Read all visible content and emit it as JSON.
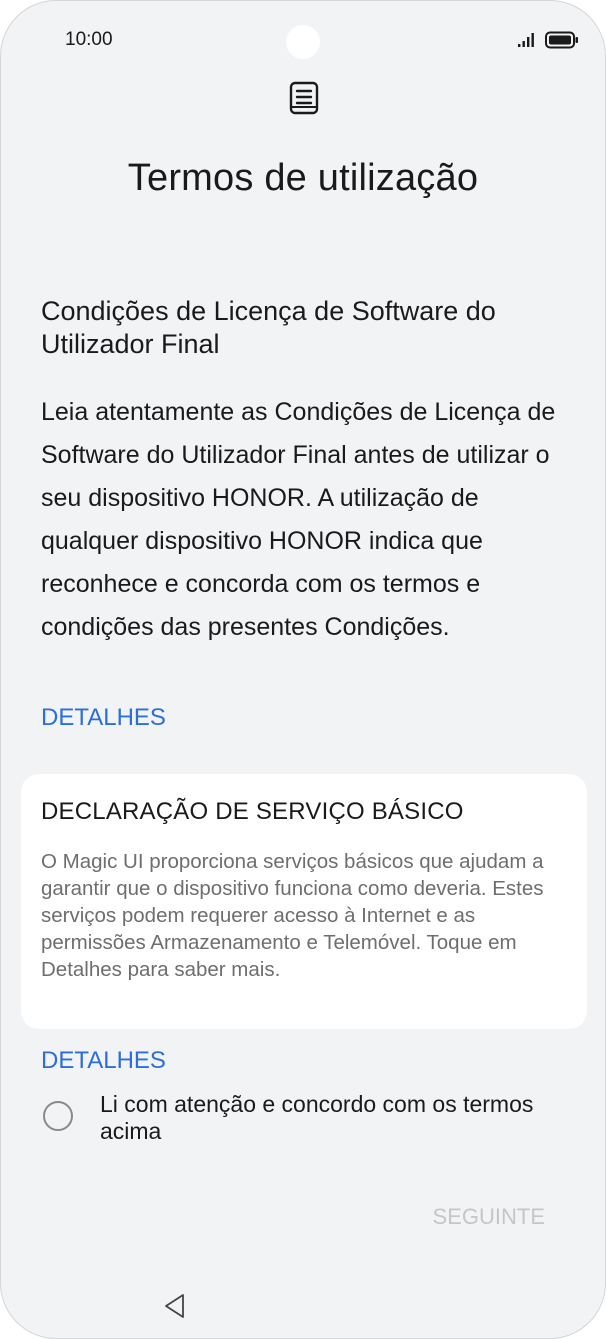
{
  "status_bar": {
    "time": "10:00",
    "icons": [
      "signal-icon",
      "battery-icon"
    ]
  },
  "header": {
    "icon": "document-icon",
    "title": "Termos de utilização"
  },
  "eula": {
    "title": "Condições de Licença de Software do Utilizador Final",
    "body": "Leia atentamente as Condições de Licença de Software do Utilizador Final antes de utilizar o seu dispositivo HONOR. A utilização de qualquer dispositivo HONOR indica que reconhece e concorda com os termos e condições das presentes Condições.",
    "details_label": "DETALHES"
  },
  "basic_service": {
    "title": "DECLARAÇÃO DE SERVIÇO BÁSICO",
    "body": "O Magic UI proporciona serviços básicos que ajudam a garantir que o dispositivo funciona como deveria. Estes serviços podem requerer acesso à Internet e as permissões Armazenamento e Telemóvel. Toque em Detalhes para saber mais.",
    "details_label": "DETALHES"
  },
  "agreement": {
    "label": "Li com atenção e concordo com os termos acima",
    "checked": false
  },
  "footer": {
    "next_label": "SEGUINTE",
    "next_enabled": false
  },
  "navigation": {
    "back_icon": "back-triangle-icon"
  },
  "colors": {
    "background": "#f1f3f5",
    "accent": "#2c6fd9",
    "disabled_text": "#c4c6c9",
    "secondary_text": "#6e6e6e"
  }
}
